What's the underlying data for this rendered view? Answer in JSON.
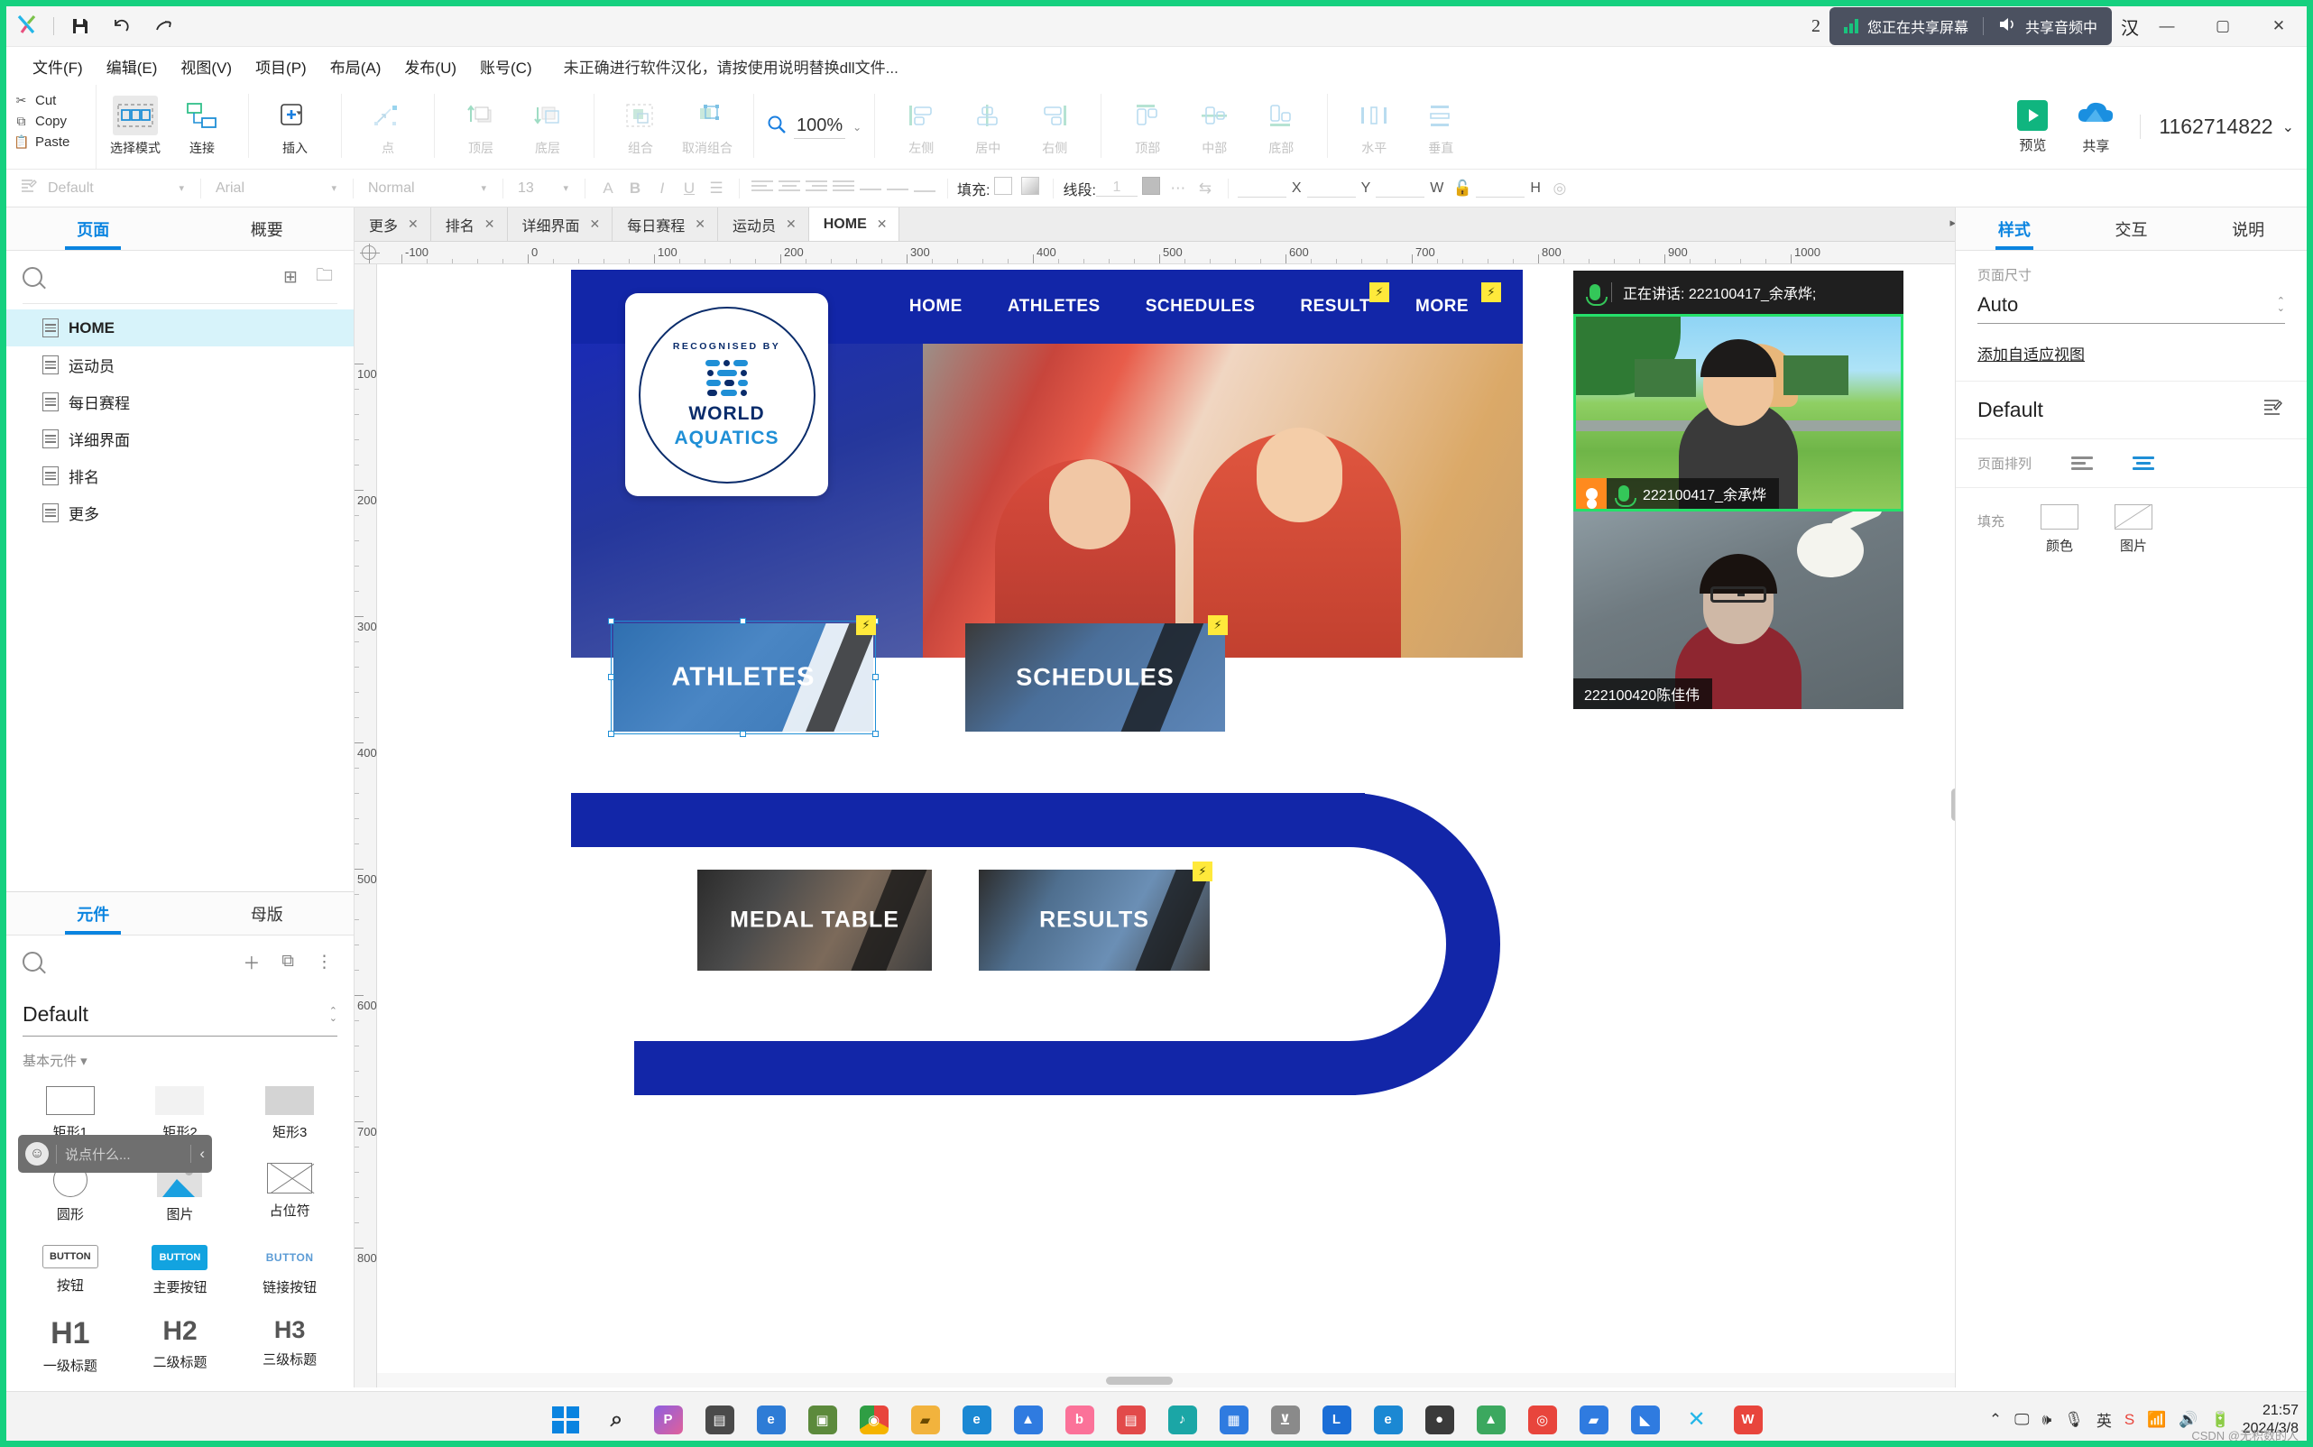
{
  "titlebar": {
    "logo": "X",
    "save_icon": "save-icon",
    "undo_icon": "undo-icon",
    "redo_icon": "redo-icon",
    "notif_count": "2",
    "share_screen_text": "您正在共享屏幕",
    "share_audio_text": "共享音频中",
    "behind_text": "汉",
    "minimize": "—",
    "maximize": "▢",
    "close": "✕"
  },
  "menubar": {
    "items": [
      "文件(F)",
      "编辑(E)",
      "视图(V)",
      "项目(P)",
      "布局(A)",
      "发布(U)",
      "账号(C)"
    ],
    "notice": "未正确进行软件汉化，请按使用说明替换dll文件..."
  },
  "clipboard": {
    "cut": "Cut",
    "copy": "Copy",
    "paste": "Paste"
  },
  "ribbon": {
    "items": [
      {
        "label": "选择模式",
        "icon": "select-mode-icon",
        "disabled": false
      },
      {
        "label": "连接",
        "icon": "connect-icon",
        "disabled": false
      },
      {
        "label": "插入",
        "icon": "insert-plus-icon",
        "disabled": false
      },
      {
        "label": "点",
        "icon": "point-icon",
        "disabled": true
      },
      {
        "label": "顶层",
        "icon": "bring-to-front-icon",
        "disabled": true
      },
      {
        "label": "底层",
        "icon": "send-to-back-icon",
        "disabled": true
      },
      {
        "label": "组合",
        "icon": "group-icon",
        "disabled": true
      },
      {
        "label": "取消组合",
        "icon": "ungroup-icon",
        "disabled": true
      },
      {
        "label": "左侧",
        "icon": "align-left-icon",
        "disabled": true
      },
      {
        "label": "居中",
        "icon": "align-center-icon",
        "disabled": true
      },
      {
        "label": "右侧",
        "icon": "align-right-icon",
        "disabled": true
      },
      {
        "label": "顶部",
        "icon": "align-top-icon",
        "disabled": true
      },
      {
        "label": "中部",
        "icon": "align-middle-icon",
        "disabled": true
      },
      {
        "label": "底部",
        "icon": "align-bottom-icon",
        "disabled": true
      },
      {
        "label": "水平",
        "icon": "distribute-horizontal-icon",
        "disabled": true
      },
      {
        "label": "垂直",
        "icon": "distribute-vertical-icon",
        "disabled": true
      }
    ],
    "zoom_value": "100%",
    "preview_label": "预览",
    "share_label": "共享",
    "account_id": "1162714822"
  },
  "formatbar": {
    "style_name": "Default",
    "font_family": "Arial",
    "font_weight": "Normal",
    "font_size": "13",
    "fill_label": "填充:",
    "line_label": "线段:",
    "line_width": "1",
    "x_label": "X",
    "y_label": "Y",
    "w_label": "W",
    "h_label": "H"
  },
  "left_panel": {
    "tabs": [
      {
        "label": "页面",
        "active": true
      },
      {
        "label": "概要",
        "active": false
      }
    ],
    "add_page_icon": "add-page-icon",
    "add_folder_icon": "add-folder-icon",
    "pages": [
      {
        "label": "HOME",
        "selected": true
      },
      {
        "label": "运动员",
        "selected": false
      },
      {
        "label": "每日赛程",
        "selected": false
      },
      {
        "label": "详细界面",
        "selected": false
      },
      {
        "label": "排名",
        "selected": false
      },
      {
        "label": "更多",
        "selected": false
      }
    ],
    "widget_tabs": [
      {
        "label": "元件",
        "active": true
      },
      {
        "label": "母版",
        "active": false
      }
    ],
    "library_name": "Default",
    "category": "基本元件",
    "widgets": [
      {
        "label": "矩形1",
        "icon": "rectangle-1-icon"
      },
      {
        "label": "矩形2",
        "icon": "rectangle-2-icon"
      },
      {
        "label": "矩形3",
        "icon": "rectangle-3-icon"
      },
      {
        "label": "圆形",
        "icon": "circle-icon"
      },
      {
        "label": "图片",
        "icon": "image-icon"
      },
      {
        "label": "占位符",
        "icon": "placeholder-icon"
      },
      {
        "label": "按钮",
        "icon": "button-icon",
        "glyph": "BUTTON"
      },
      {
        "label": "主要按钮",
        "icon": "primary-button-icon",
        "glyph": "BUTTON"
      },
      {
        "label": "链接按钮",
        "icon": "link-button-icon",
        "glyph": "BUTTON"
      },
      {
        "label": "一级标题",
        "icon": "heading-1-icon",
        "glyph": "H1"
      },
      {
        "label": "二级标题",
        "icon": "heading-2-icon",
        "glyph": "H2"
      },
      {
        "label": "三级标题",
        "icon": "heading-3-icon",
        "glyph": "H3"
      }
    ],
    "chat": {
      "placeholder": "说点什么...",
      "emoji_icon": "emoji-icon",
      "collapse_icon": "chevron-left-icon"
    }
  },
  "canvas": {
    "tabs": [
      {
        "label": "更多",
        "active": false
      },
      {
        "label": "排名",
        "active": false
      },
      {
        "label": "详细界面",
        "active": false
      },
      {
        "label": "每日赛程",
        "active": false
      },
      {
        "label": "运动员",
        "active": false
      },
      {
        "label": "HOME",
        "active": true
      }
    ],
    "ruler_h": [
      "-100",
      "0",
      "100",
      "200",
      "300",
      "400",
      "500",
      "600",
      "700",
      "800",
      "900",
      "1000"
    ],
    "ruler_v": [
      "100",
      "200",
      "300",
      "400",
      "500",
      "600",
      "700",
      "800"
    ],
    "mockup": {
      "logo": {
        "top_text": "RECOGNISED BY",
        "line1": "WORLD",
        "line2": "AQUATICS"
      },
      "nav": [
        "HOME",
        "ATHLETES",
        "SCHEDULES",
        "RESULT",
        "MORE"
      ],
      "cards": [
        {
          "title": "ATHLETES",
          "selected": true
        },
        {
          "title": "SCHEDULES",
          "selected": false
        },
        {
          "title": "MEDAL TABLE",
          "selected": false
        },
        {
          "title": "RESULTS",
          "selected": false
        }
      ]
    }
  },
  "video": {
    "speaking_prefix": "正在讲话:",
    "speaking_name": "222100417_余承烨",
    "speaking_full": "正在讲话:  222100417_余承烨;",
    "tiles": [
      {
        "name": "222100417_余承烨",
        "active": true,
        "mic": "mic-on-icon"
      },
      {
        "name": "222100420陈佳伟",
        "active": false,
        "mic": "none"
      }
    ]
  },
  "right_panel": {
    "tabs": [
      {
        "label": "样式",
        "active": true
      },
      {
        "label": "交互",
        "active": false
      },
      {
        "label": "说明",
        "active": false
      }
    ],
    "page_size_label": "页面尺寸",
    "page_size_value": "Auto",
    "adaptive_link": "添加自适应视图",
    "style_name": "Default",
    "edit_icon": "edit-style-icon",
    "page_align_label": "页面排列",
    "fill_label": "填充",
    "fill_color_label": "颜色",
    "fill_image_label": "图片"
  },
  "taskbar": {
    "apps": [
      {
        "name": "start-button",
        "glyph": "",
        "color": "#0a84e0"
      },
      {
        "name": "search-icon",
        "glyph": "⌕",
        "color": "#f3f3f3"
      },
      {
        "name": "pixpin-icon",
        "glyph": "P",
        "color": "#8e5fe0"
      },
      {
        "name": "task-view-icon",
        "glyph": "▤",
        "color": "#4a4a4a"
      },
      {
        "name": "edge-dev-icon",
        "glyph": "e",
        "color": "#2e7cd6"
      },
      {
        "name": "minecraft-icon",
        "glyph": "▣",
        "color": "#5c8a3c"
      },
      {
        "name": "chrome-icon",
        "glyph": "◉",
        "color": "#e8453c"
      },
      {
        "name": "file-explorer-icon",
        "glyph": "▰",
        "color": "#f2b33d"
      },
      {
        "name": "edge-icon",
        "glyph": "e",
        "color": "#1b88d3"
      },
      {
        "name": "mountain-icon",
        "glyph": "▲",
        "color": "#2f7be0"
      },
      {
        "name": "bilibili-icon",
        "glyph": "b",
        "color": "#fb7299"
      },
      {
        "name": "wechat-icon",
        "glyph": "▤",
        "color": "#e24a4a"
      },
      {
        "name": "douyin-icon",
        "glyph": "♪",
        "color": "#1ba6a6"
      },
      {
        "name": "store-icon",
        "glyph": "▦",
        "color": "#2f7be0"
      },
      {
        "name": "tool-icon",
        "glyph": "⊻",
        "color": "#8a8a8a"
      },
      {
        "name": "lanxin-icon",
        "glyph": "L",
        "color": "#1b6ed6"
      },
      {
        "name": "ie-icon",
        "glyph": "e",
        "color": "#1b88d3"
      },
      {
        "name": "penguin-icon",
        "glyph": "●",
        "color": "#3a3a3a"
      },
      {
        "name": "wps-green-icon",
        "glyph": "▲",
        "color": "#3ca85f"
      },
      {
        "name": "tencent-meeting-icon",
        "glyph": "◎",
        "color": "#e8453c"
      },
      {
        "name": "folder-blue-icon",
        "glyph": "▰",
        "color": "#2f7be0"
      },
      {
        "name": "vscode-icon",
        "glyph": "◣",
        "color": "#2f7be0"
      },
      {
        "name": "axure-icon",
        "glyph": "X",
        "color": "#f3f3f3"
      },
      {
        "name": "wps-icon",
        "glyph": "W",
        "color": "#e8453c"
      }
    ],
    "tray": {
      "chevron": "⌃",
      "monitor_icon": "monitor-icon",
      "volume_icon": "volume-icon",
      "mic_icon": "mic-icon",
      "ime_icon": "英",
      "sogou_icon": "S",
      "wifi_icon": "wifi-icon",
      "speaker_icon": "speaker-icon",
      "battery_icon": "battery-icon",
      "time": "21:57",
      "date": "2024/3/8"
    },
    "watermark": "CSDN @无积数的人"
  }
}
